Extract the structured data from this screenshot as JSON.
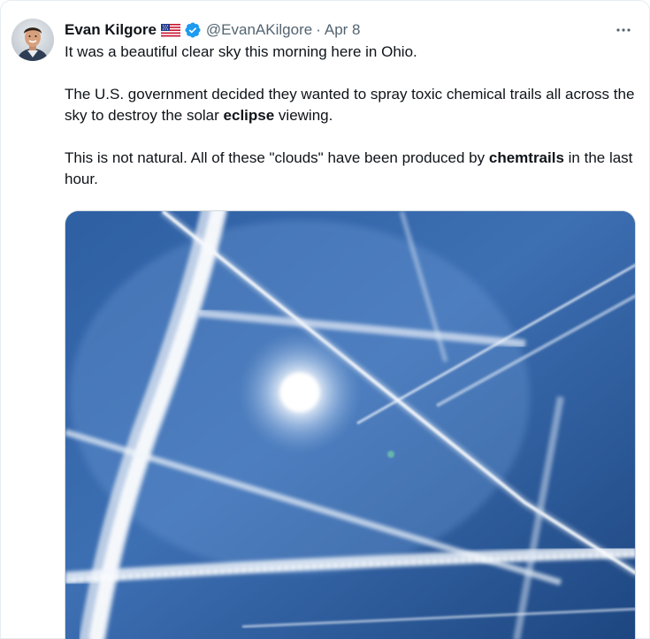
{
  "tweet": {
    "author_name": "Evan Kilgore",
    "flag_icon": "us-flag-icon",
    "verified_icon": "verified-badge-icon",
    "handle": "@EvanAKilgore",
    "separator": "·",
    "date": "Apr 8",
    "more_icon": "more-options-icon",
    "paragraph1": "It was a beautiful clear sky this morning here in Ohio.",
    "paragraph2": {
      "part1": "The U.S. government decided they wanted to spray toxic chemical trails all across the sky to destroy the solar ",
      "bold": "eclipse",
      "part2": " viewing."
    },
    "paragraph3": {
      "part1": "This is not natural. All of these \"clouds\" have been produced by ",
      "bold": "chemtrails",
      "part2": " in the last hour."
    }
  },
  "colors": {
    "text": "#0f1419",
    "secondary": "#536471",
    "verified": "#1d9bf0",
    "sky_dark": "#1f4a85",
    "sky_light": "#5b8fd0"
  }
}
